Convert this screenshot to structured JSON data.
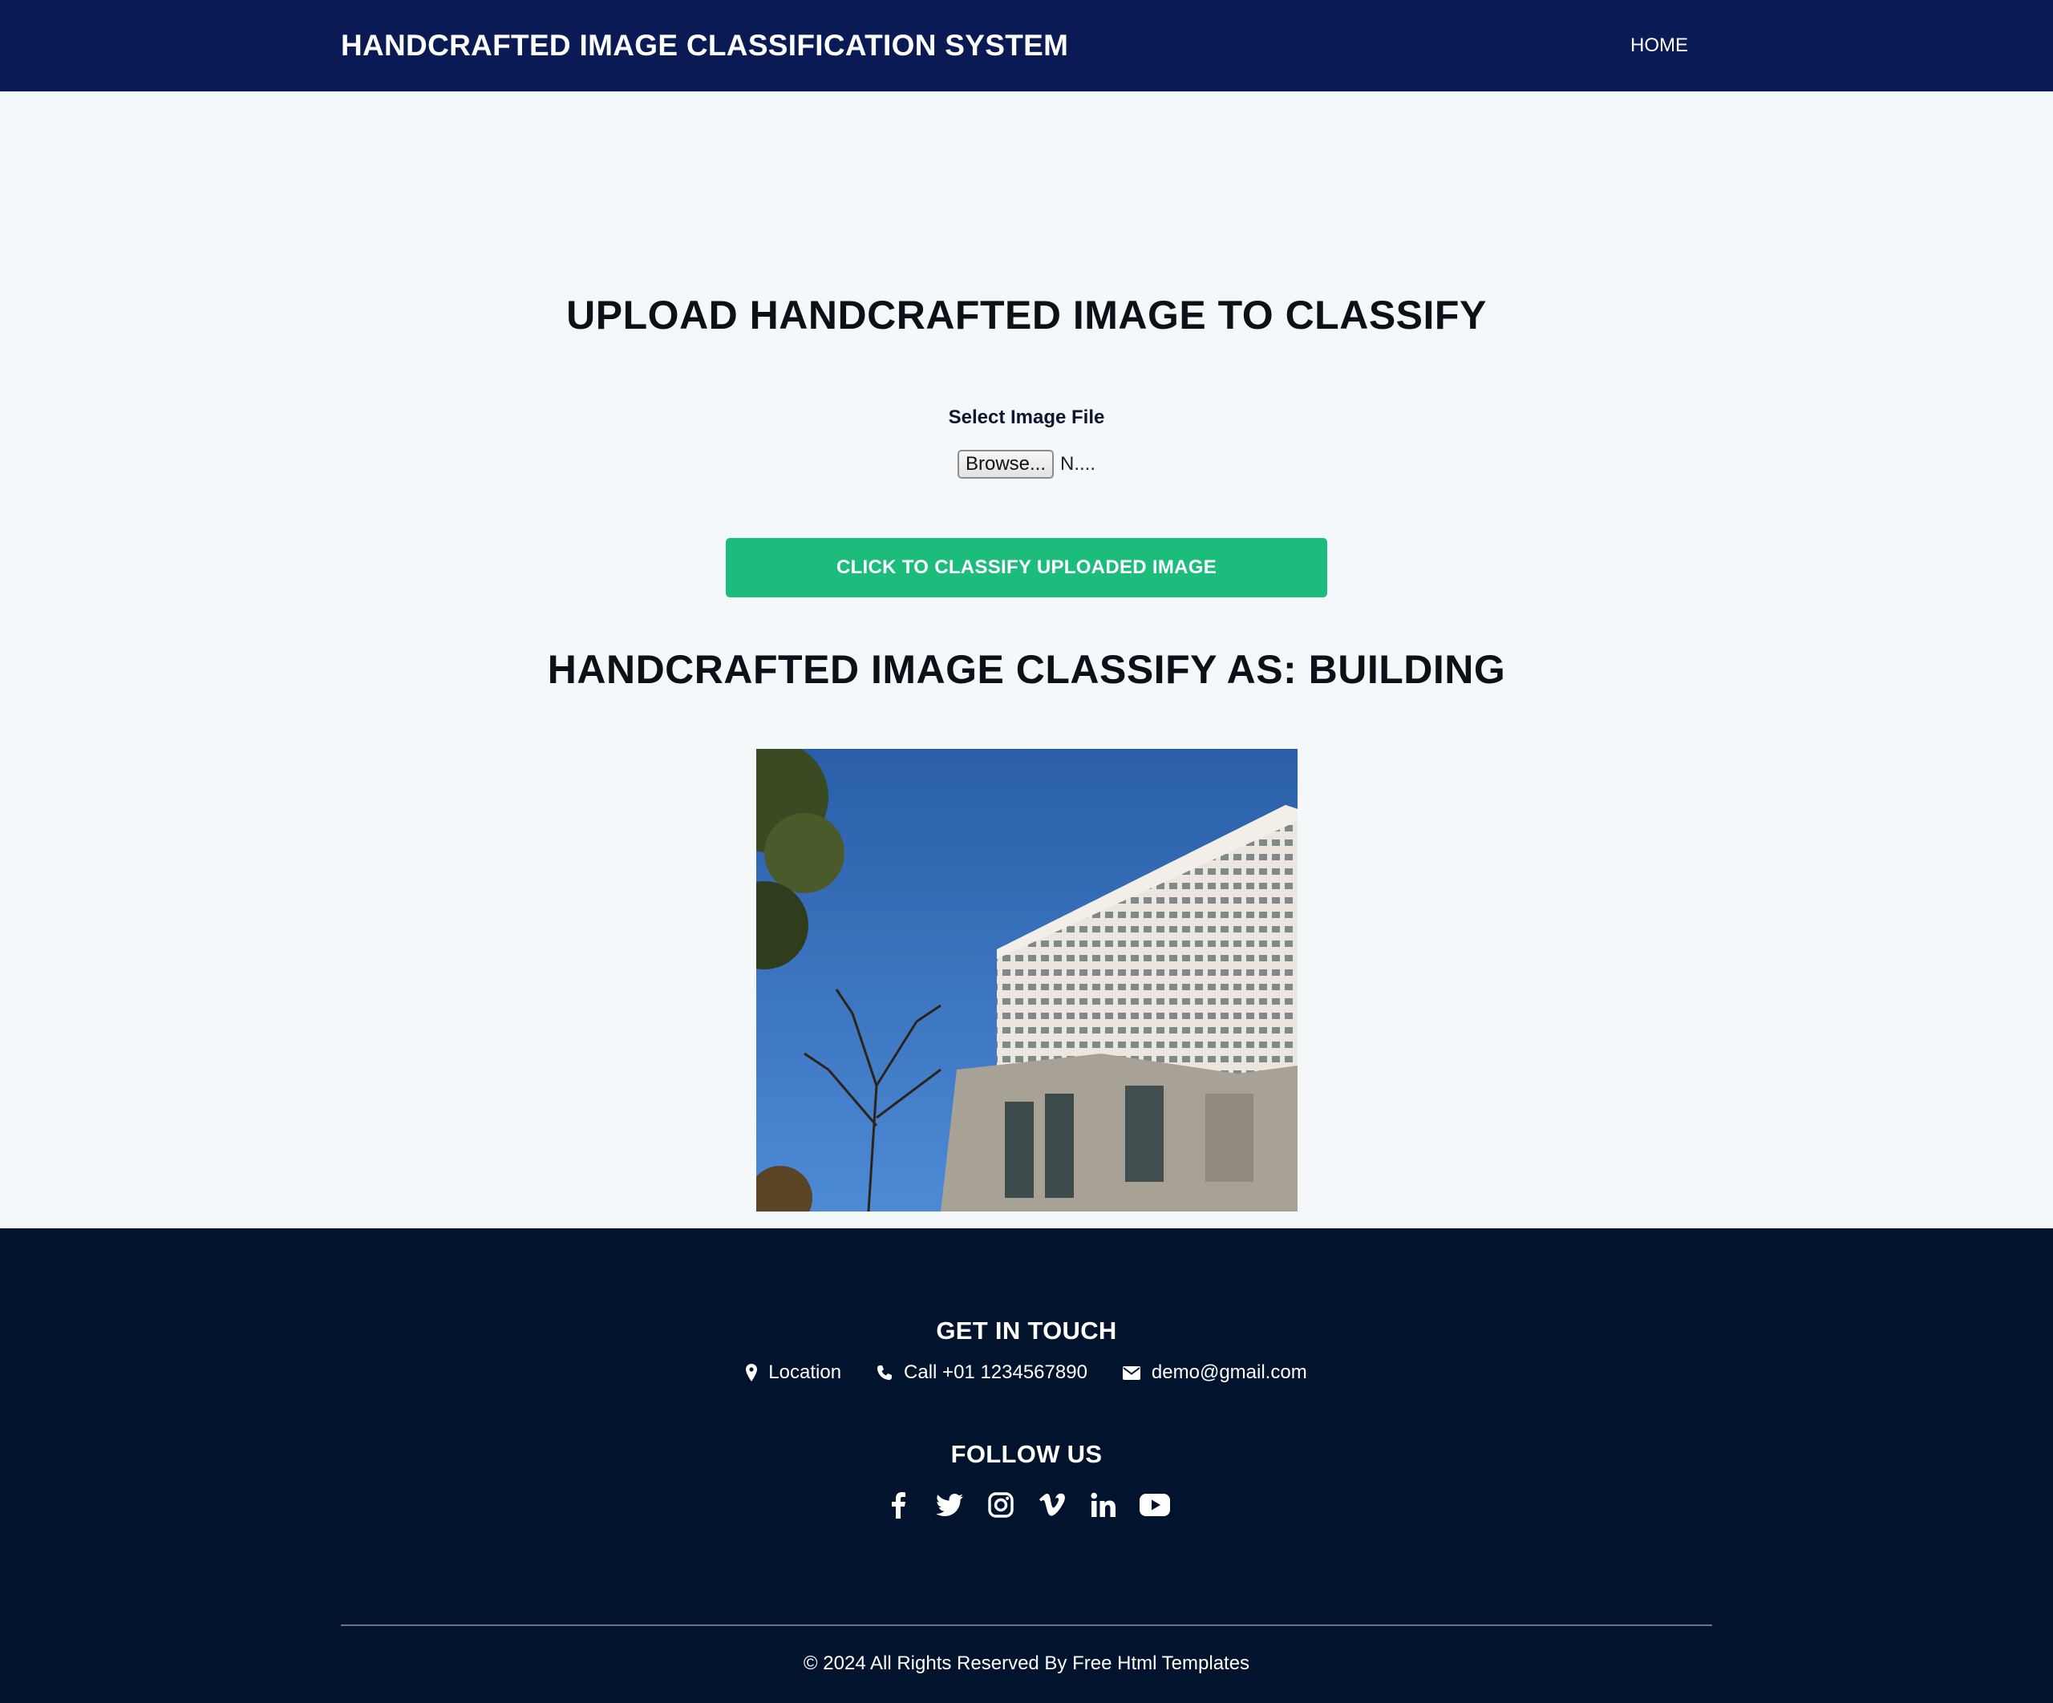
{
  "header": {
    "brand": "HANDCRAFTED IMAGE CLASSIFICATION SYSTEM",
    "nav": {
      "home": "HOME"
    },
    "background": "#0a1a55"
  },
  "upload": {
    "heading": "UPLOAD HANDCRAFTED IMAGE TO CLASSIFY",
    "file_label": "Select Image File",
    "browse_label": "Browse...",
    "file_name": "N....",
    "classify_button": "CLICK TO CLASSIFY UPLOADED IMAGE",
    "button_color": "#1bbc7c"
  },
  "result": {
    "heading": "HANDCRAFTED IMAGE CLASSIFY AS: BUILDING"
  },
  "footer": {
    "contact_heading": "GET IN TOUCH",
    "contact": {
      "location": "Location",
      "phone": "Call +01 1234567890",
      "email": "demo@gmail.com"
    },
    "follow_heading": "FOLLOW US",
    "social_icons": [
      "facebook-icon",
      "twitter-icon",
      "instagram-icon",
      "vimeo-icon",
      "linkedin-icon",
      "youtube-icon"
    ],
    "copyright": "© 2024 All Rights Reserved By Free Html Templates",
    "background": "#01132d"
  }
}
